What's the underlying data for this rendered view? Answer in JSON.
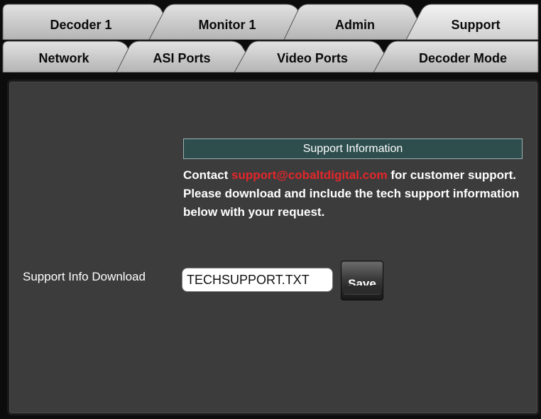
{
  "tabs_primary": [
    {
      "label": "Decoder 1",
      "active": false
    },
    {
      "label": "Monitor 1",
      "active": false
    },
    {
      "label": "Admin",
      "active": false
    },
    {
      "label": "Support",
      "active": true
    }
  ],
  "tabs_secondary": [
    {
      "label": "Network"
    },
    {
      "label": "ASI Ports"
    },
    {
      "label": "Video Ports"
    },
    {
      "label": "Decoder Mode"
    }
  ],
  "support": {
    "section_title": "Support Information",
    "contact_prefix": "Contact ",
    "contact_email": "support@cobaltdigital.com",
    "contact_suffix": " for customer support. Please download and include the tech support information below with your request.",
    "download_label": "Support Info Download",
    "file_value": "TECHSUPPORT.TXT",
    "save_label": "Save"
  },
  "colors": {
    "accent_email": "#e4262a",
    "section_header_bg": "#2e4e4e",
    "panel_bg": "#3c3c3c",
    "tab_bg": "#cfcfcf",
    "tab_active_bg": "#e6e6e6"
  }
}
